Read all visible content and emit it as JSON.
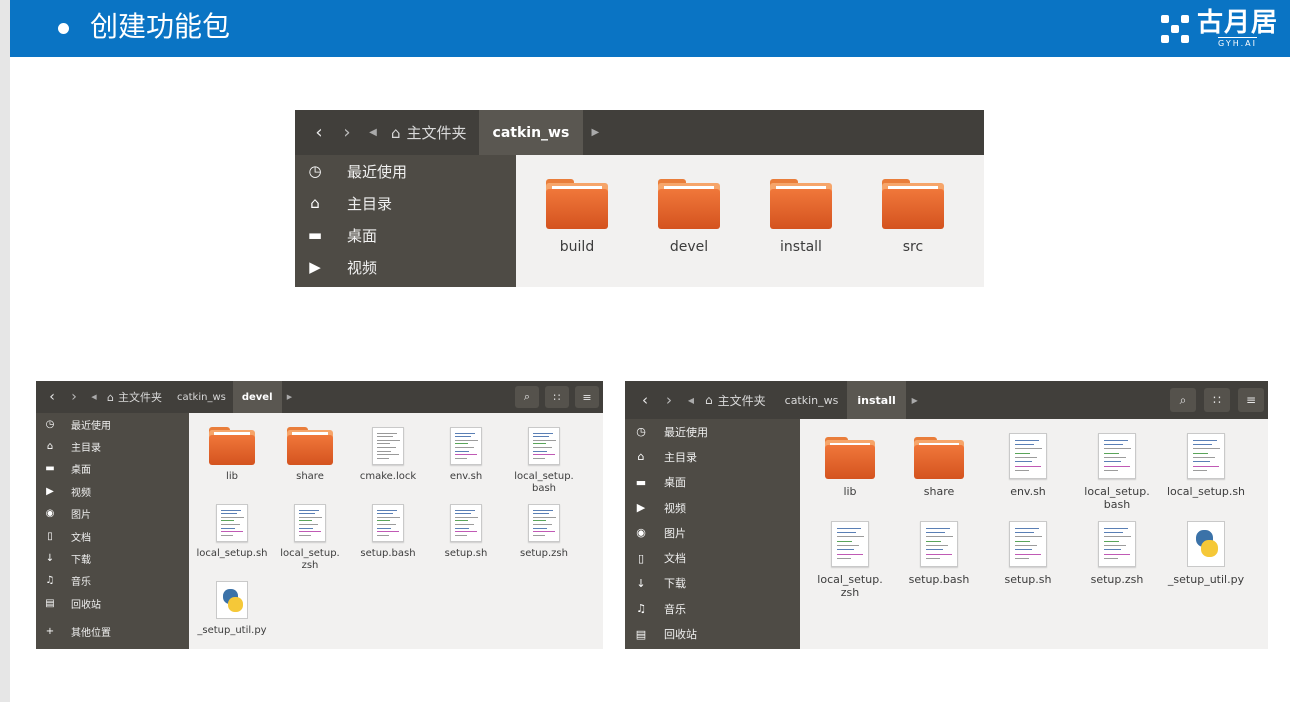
{
  "slide": {
    "title": "创建功能包",
    "logo_name": "古月居",
    "logo_sub": "GYH.AI"
  },
  "win1": {
    "path": [
      "主文件夹",
      "catkin_ws"
    ],
    "sidebar": [
      {
        "icon": "clock-icon",
        "label": "最近使用"
      },
      {
        "icon": "home-icon",
        "label": "主目录"
      },
      {
        "icon": "desktop-icon",
        "label": "桌面"
      },
      {
        "icon": "video-icon",
        "label": "视频"
      }
    ],
    "items": [
      {
        "type": "folder",
        "name": "build"
      },
      {
        "type": "folder",
        "name": "devel"
      },
      {
        "type": "folder",
        "name": "install"
      },
      {
        "type": "folder",
        "name": "src"
      }
    ]
  },
  "win2": {
    "path": [
      "主文件夹",
      "catkin_ws",
      "devel"
    ],
    "sidebar": [
      {
        "icon": "clock-icon",
        "label": "最近使用"
      },
      {
        "icon": "home-icon",
        "label": "主目录"
      },
      {
        "icon": "desktop-icon",
        "label": "桌面"
      },
      {
        "icon": "video-icon",
        "label": "视频"
      },
      {
        "icon": "camera-icon",
        "label": "图片"
      },
      {
        "icon": "document-icon",
        "label": "文档"
      },
      {
        "icon": "download-icon",
        "label": "下载"
      },
      {
        "icon": "music-icon",
        "label": "音乐"
      },
      {
        "icon": "trash-icon",
        "label": "回收站"
      },
      {
        "icon": "plus-icon",
        "label": "其他位置"
      }
    ],
    "items": [
      {
        "type": "folder",
        "name": "lib"
      },
      {
        "type": "folder",
        "name": "share"
      },
      {
        "type": "text",
        "name": "cmake.lock"
      },
      {
        "type": "script",
        "name": "env.sh"
      },
      {
        "type": "script",
        "name": "local_setup.\nbash"
      },
      {
        "type": "script",
        "name": "local_setup.sh"
      },
      {
        "type": "script",
        "name": "local_setup.\nzsh"
      },
      {
        "type": "script",
        "name": "setup.bash"
      },
      {
        "type": "script",
        "name": "setup.sh"
      },
      {
        "type": "script",
        "name": "setup.zsh"
      },
      {
        "type": "python",
        "name": "_setup_util.py"
      }
    ]
  },
  "win3": {
    "path": [
      "主文件夹",
      "catkin_ws",
      "install"
    ],
    "sidebar": [
      {
        "icon": "clock-icon",
        "label": "最近使用"
      },
      {
        "icon": "home-icon",
        "label": "主目录"
      },
      {
        "icon": "desktop-icon",
        "label": "桌面"
      },
      {
        "icon": "video-icon",
        "label": "视频"
      },
      {
        "icon": "camera-icon",
        "label": "图片"
      },
      {
        "icon": "document-icon",
        "label": "文档"
      },
      {
        "icon": "download-icon",
        "label": "下载"
      },
      {
        "icon": "music-icon",
        "label": "音乐"
      },
      {
        "icon": "trash-icon",
        "label": "回收站"
      }
    ],
    "items": [
      {
        "type": "folder",
        "name": "lib"
      },
      {
        "type": "folder",
        "name": "share"
      },
      {
        "type": "script",
        "name": "env.sh"
      },
      {
        "type": "script",
        "name": "local_setup.\nbash"
      },
      {
        "type": "script",
        "name": "local_setup.sh"
      },
      {
        "type": "script",
        "name": "local_setup.\nzsh"
      },
      {
        "type": "script",
        "name": "setup.bash"
      },
      {
        "type": "script",
        "name": "setup.sh"
      },
      {
        "type": "script",
        "name": "setup.zsh"
      },
      {
        "type": "python",
        "name": "_setup_util.py"
      }
    ]
  }
}
